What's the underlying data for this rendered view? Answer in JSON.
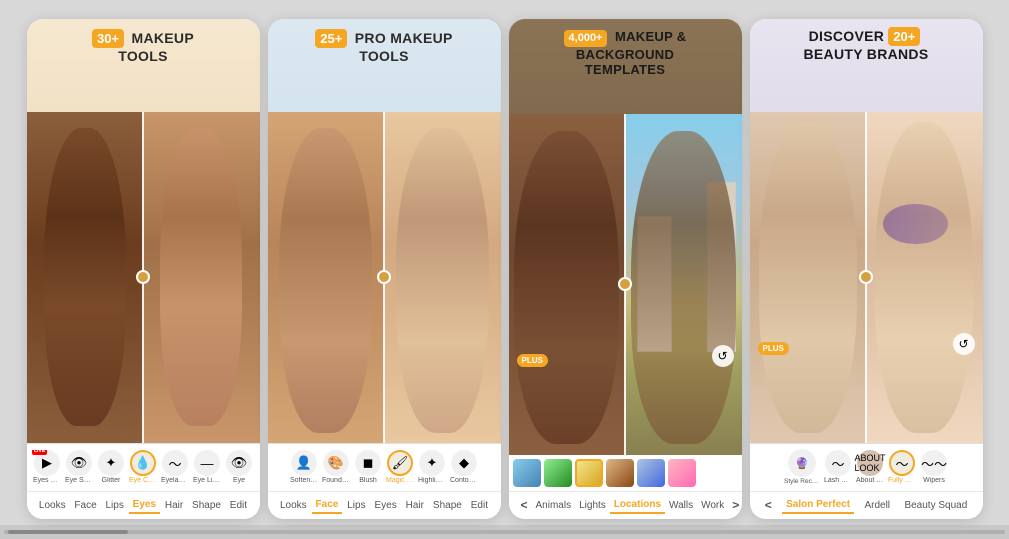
{
  "cards": [
    {
      "id": "card1",
      "badge": "30+",
      "headline_line1": "MAKEUP",
      "headline_line2": "TOOLS",
      "tools": [
        {
          "icon": "▶",
          "label": "Eyes Video",
          "live": true,
          "active": false
        },
        {
          "icon": "👁",
          "label": "Eye Shadow",
          "active": false
        },
        {
          "icon": "✨",
          "label": "Glitter",
          "active": false
        },
        {
          "icon": "💧",
          "label": "Eye Concealer",
          "active": true
        },
        {
          "icon": "〜",
          "label": "Eyelashes",
          "active": false
        },
        {
          "icon": "—",
          "label": "Eye Liner",
          "active": false
        },
        {
          "icon": "👁",
          "label": "Eye",
          "active": false
        }
      ],
      "nav_items": [
        {
          "label": "Looks",
          "active": false
        },
        {
          "label": "Face",
          "active": false
        },
        {
          "label": "Lips",
          "active": false
        },
        {
          "label": "Eyes",
          "active": true
        },
        {
          "label": "Hair",
          "active": false
        },
        {
          "label": "Shape",
          "active": false
        },
        {
          "label": "Edit",
          "active": false
        }
      ]
    },
    {
      "id": "card2",
      "badge": "25+",
      "headline_line1": "PRO MAKEUP",
      "headline_line2": "TOOLS",
      "tools": [
        {
          "icon": "👤",
          "label": "Soften Skin",
          "active": false
        },
        {
          "icon": "🎨",
          "label": "Foundation",
          "active": false
        },
        {
          "icon": "◼",
          "label": "Blush",
          "active": false
        },
        {
          "icon": "🖌",
          "label": "Magic Brush No.",
          "active": true
        },
        {
          "icon": "✦",
          "label": "Highlight it",
          "active": false
        },
        {
          "icon": "◆",
          "label": "Contour it",
          "active": false
        }
      ],
      "nav_items": [
        {
          "label": "Looks",
          "active": false
        },
        {
          "label": "Face",
          "active": true
        },
        {
          "label": "Lips",
          "active": false
        },
        {
          "label": "Eyes",
          "active": false
        },
        {
          "label": "Hair",
          "active": false
        },
        {
          "label": "Shape",
          "active": false
        },
        {
          "label": "Edit",
          "active": false
        }
      ]
    },
    {
      "id": "card3",
      "badge": "4,000+",
      "headline_line1": "MAKEUP &",
      "headline_line2": "BACKGROUND",
      "headline_line3": "TEMPLATES",
      "thumbnails": [
        "t1",
        "t2",
        "t3",
        "t4",
        "t5",
        "t6"
      ],
      "nav_items": [
        {
          "label": "<",
          "active": false
        },
        {
          "label": "Animals",
          "active": false
        },
        {
          "label": "Lights",
          "active": false
        },
        {
          "label": "Locations",
          "active": true
        },
        {
          "label": "Walls",
          "active": false
        },
        {
          "label": "Work",
          "active": false
        },
        {
          "label": ">",
          "active": false
        }
      ]
    },
    {
      "id": "card4",
      "badge": "20+",
      "headline_line1": "DISCOVER",
      "headline_line2": "BEAUTY BRANDS",
      "tools": [
        {
          "icon": "🔮",
          "label": "Style Recommendation Wizard",
          "active": false
        },
        {
          "icon": "〜",
          "label": "Lash DNA",
          "active": false
        },
        {
          "icon": "📖",
          "label": "About Look",
          "active": false
        },
        {
          "icon": "〜",
          "label": "Fully Stacked",
          "active": true
        },
        {
          "icon": "〜",
          "label": "Wipers",
          "active": false
        }
      ],
      "brands": [
        {
          "label": "Salon Perfect",
          "active": true
        },
        {
          "label": "Ardell",
          "active": false
        },
        {
          "label": "Beauty Squad",
          "active": false
        }
      ]
    }
  ],
  "scrollbar": {
    "label": "scroll"
  }
}
